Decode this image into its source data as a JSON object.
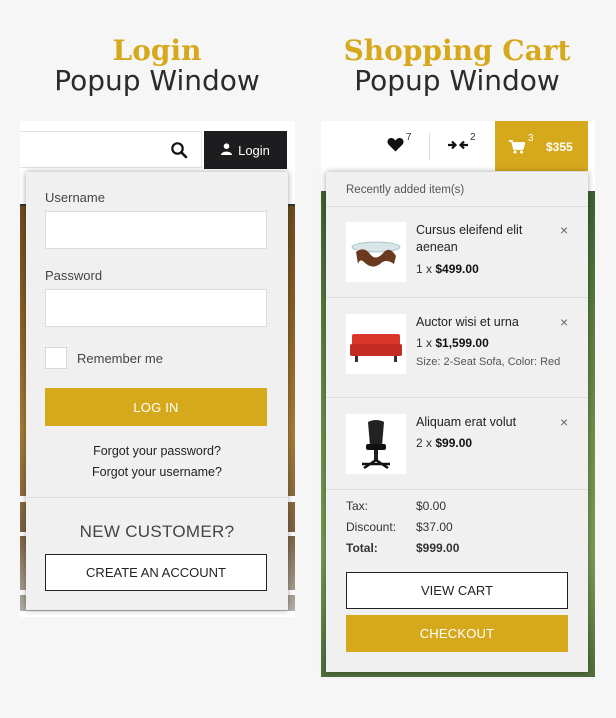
{
  "left_heading": {
    "accent": "Login",
    "sub": "Popup Window"
  },
  "right_heading": {
    "accent": "Shopping Cart",
    "sub": "Popup Window"
  },
  "login_header": {
    "login_button": "Login"
  },
  "login_popup": {
    "username_label": "Username",
    "username_value": "",
    "password_label": "Password",
    "password_value": "",
    "remember_label": "Remember me",
    "remember_checked": false,
    "login_button": "LOG IN",
    "forgot_password": "Forgot your password?",
    "forgot_username": "Forgot your username?",
    "new_customer": "NEW CUSTOMER?",
    "create_account": "CREATE AN ACCOUNT"
  },
  "cart_header": {
    "wishlist_count": "7",
    "compare_count": "2",
    "cart_count": "3",
    "cart_total": "$355"
  },
  "cart_popup": {
    "recent_label": "Recently added item(s)",
    "items": [
      {
        "name": "Cursus eleifend elit aenean",
        "qty": "1 x",
        "price": "$499.00",
        "options": ""
      },
      {
        "name": "Auctor wisi et urna",
        "qty": "1 x",
        "price": "$1,599.00",
        "options": "Size: 2-Seat Sofa, Color: Red"
      },
      {
        "name": "Aliquam erat volut",
        "qty": "2 x",
        "price": "$99.00",
        "options": ""
      }
    ],
    "remove_symbol": "×",
    "summary": {
      "tax_label": "Tax:",
      "tax_value": "$0.00",
      "discount_label": "Discount:",
      "discount_value": "$37.00",
      "total_label": "Total:",
      "total_value": "$999.00"
    },
    "view_cart": "VIEW CART",
    "checkout": "CHECKOUT"
  },
  "colors": {
    "accent": "#d6a91c",
    "dark_button": "#1d1d1f",
    "popup_bg": "#f0f0f0"
  }
}
